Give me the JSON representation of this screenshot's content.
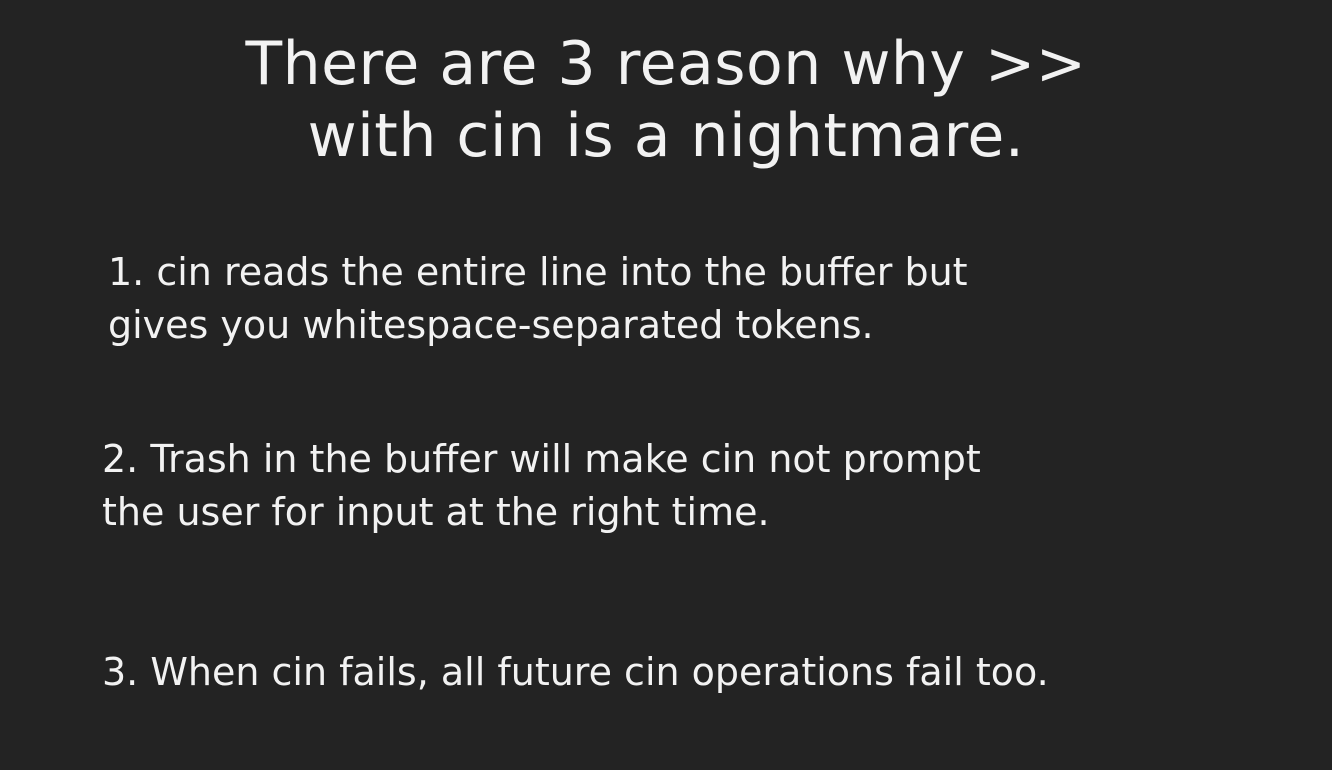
{
  "slide": {
    "title_lines": [
      "There are 3 reason why >>",
      "with cin is a nightmare."
    ],
    "points": [
      {
        "lines": [
          "1. cin reads the entire line into the buffer but",
          "gives you whitespace-separated tokens."
        ]
      },
      {
        "lines": [
          "2. Trash in the buffer will make cin not prompt",
          "the user for input at the right time."
        ]
      },
      {
        "lines": [
          "3. When cin fails, all future cin operations fail too."
        ]
      }
    ]
  },
  "colors": {
    "background": "#232323",
    "text": "#f2f2f2"
  }
}
